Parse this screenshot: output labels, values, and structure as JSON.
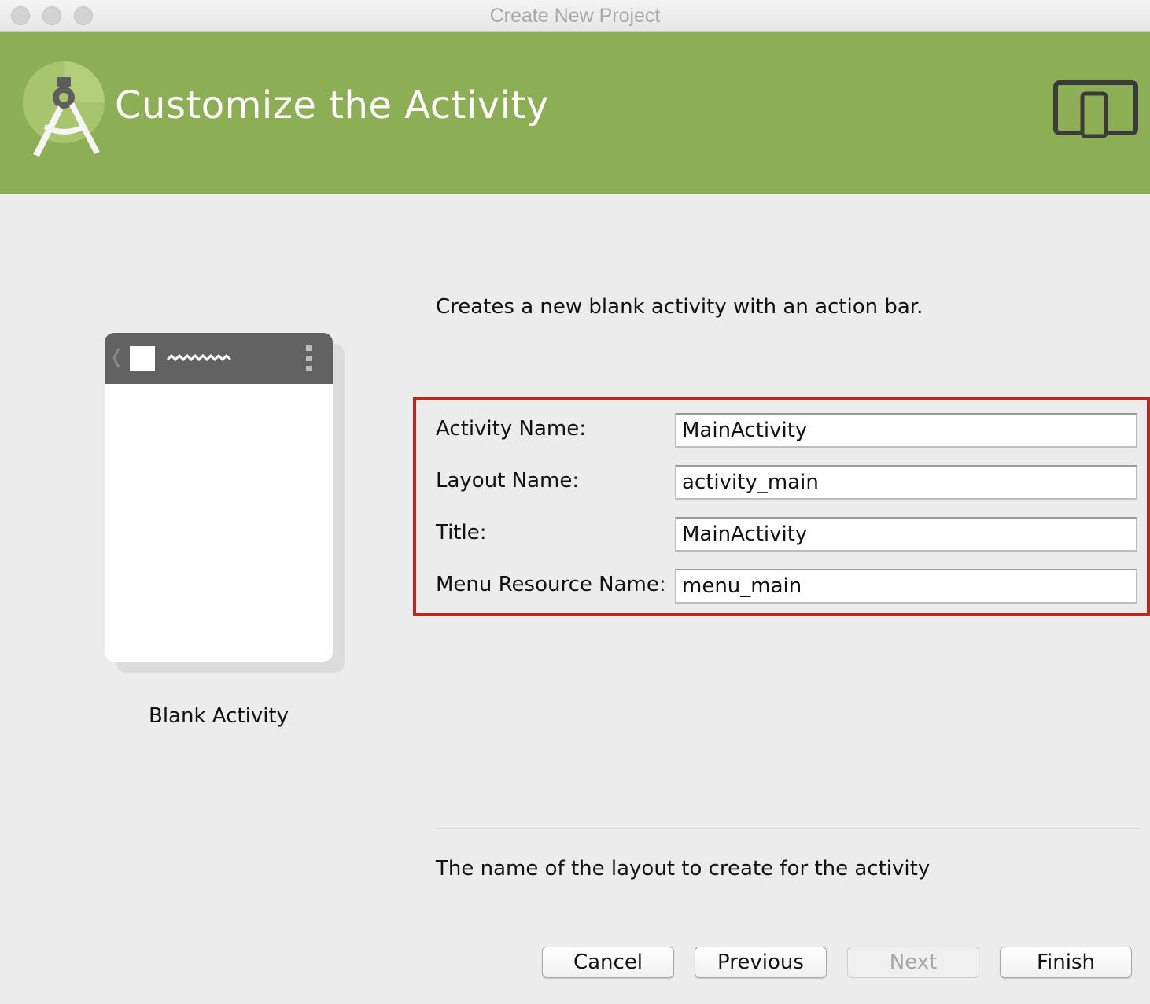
{
  "window": {
    "title": "Create New Project"
  },
  "header": {
    "title": "Customize the Activity",
    "logo_icon": "android-studio-logo-icon",
    "device_icon": "tablet-phone-icon",
    "background_color": "#8cae54"
  },
  "template": {
    "name": "Blank Activity",
    "description": "Creates a new blank activity with an action bar."
  },
  "form": {
    "highlight_color": "#c0261b",
    "fields": [
      {
        "label": "Activity Name:",
        "value": "MainActivity"
      },
      {
        "label": "Layout Name:",
        "value": "activity_main"
      },
      {
        "label": "Title:",
        "value": "MainActivity"
      },
      {
        "label": "Menu Resource Name:",
        "value": "menu_main"
      }
    ]
  },
  "hint": "The name of the layout to create for the activity",
  "buttons": {
    "cancel": "Cancel",
    "previous": "Previous",
    "next": "Next",
    "finish": "Finish"
  }
}
